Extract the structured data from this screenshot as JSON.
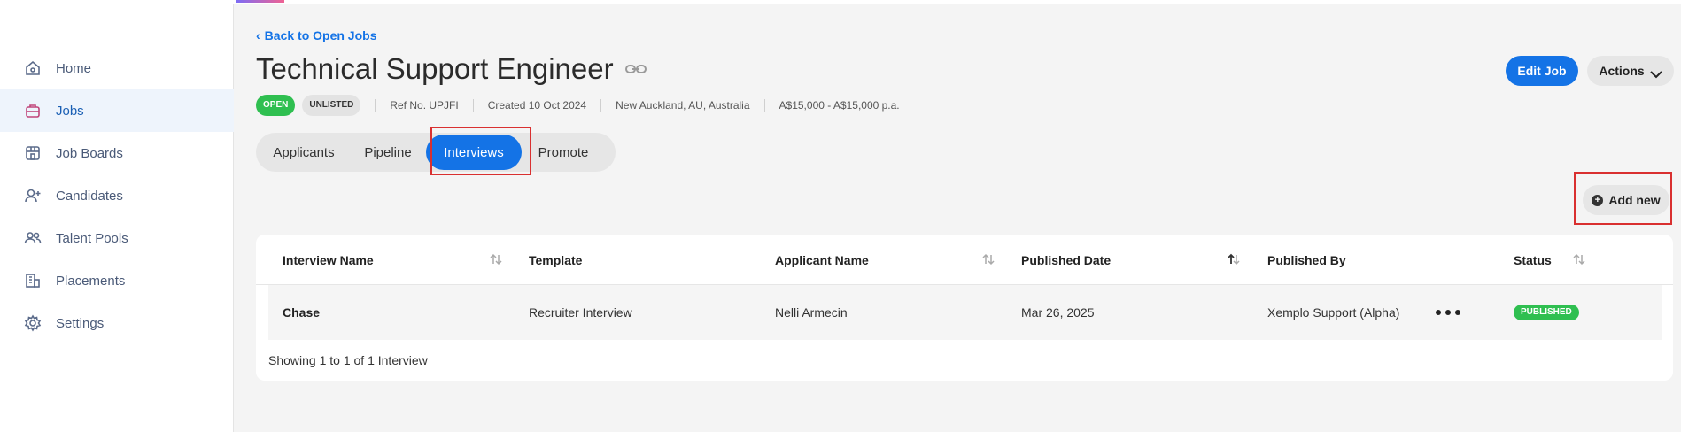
{
  "sidebar": {
    "items": [
      {
        "label": "Home",
        "icon": "home-icon"
      },
      {
        "label": "Jobs",
        "icon": "briefcase-icon",
        "active": true
      },
      {
        "label": "Job Boards",
        "icon": "storefront-icon"
      },
      {
        "label": "Candidates",
        "icon": "user-plus-icon"
      },
      {
        "label": "Talent Pools",
        "icon": "users-icon"
      },
      {
        "label": "Placements",
        "icon": "building-icon"
      },
      {
        "label": "Settings",
        "icon": "gear-icon"
      }
    ]
  },
  "header": {
    "back_label": "Back to Open Jobs",
    "title": "Technical Support Engineer",
    "badge_open": "OPEN",
    "badge_unlisted": "UNLISTED",
    "ref": "Ref No. UPJFI",
    "created": "Created 10 Oct 2024",
    "location": "New Auckland, AU, Australia",
    "salary": "A$15,000 - A$15,000 p.a.",
    "edit_label": "Edit Job",
    "actions_label": "Actions"
  },
  "tabs": {
    "applicants": "Applicants",
    "pipeline": "Pipeline",
    "interviews": "Interviews",
    "promote": "Promote",
    "active": "interviews"
  },
  "add_new_label": "Add new",
  "table": {
    "columns": [
      "Interview Name",
      "Template",
      "Applicant Name",
      "Published Date",
      "Published By",
      "Status"
    ],
    "rows": [
      {
        "interview_name": "Chase",
        "template": "Recruiter Interview",
        "applicant_name": "Nelli Armecin",
        "published_date": "Mar 26, 2025",
        "published_by": "Xemplo Support (Alpha)",
        "status": "PUBLISHED"
      }
    ],
    "footer": "Showing 1 to 1 of 1 Interview"
  },
  "colors": {
    "primary": "#1473e6",
    "success": "#2fbf50",
    "highlight": "#d93030"
  }
}
